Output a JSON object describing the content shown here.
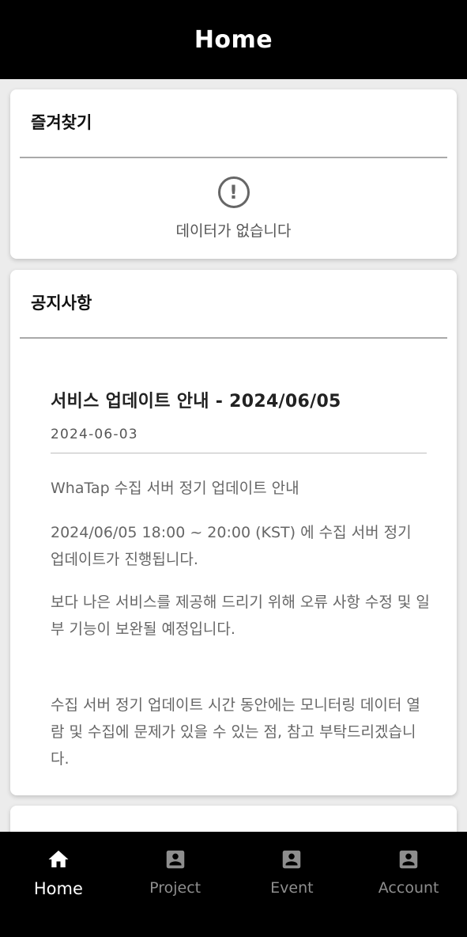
{
  "header": {
    "title": "Home"
  },
  "favorites": {
    "title": "즐겨찾기",
    "empty_icon": "alert-circle-icon",
    "empty_text": "데이터가 없습니다"
  },
  "notice": {
    "title": "공지사항",
    "items": [
      {
        "title": "서비스 업데이트 안내 - 2024/06/05",
        "date": "2024-06-03",
        "paragraphs": [
          "WhaTap 수집 서버 정기 업데이트 안내",
          "2024/06/05 18:00 ~ 20:00 (KST) 에 수집 서버 정기 업데이트가 진행됩니다.",
          "보다 나은 서비스를 제공해 드리기 위해 오류 사항 수정 및 일부 기능이 보완될 예정입니다.",
          "수집 서버 정기 업데이트 시간 동안에는 모니터링 데이터 열람 및 수집에 문제가 있을 수 있는 점, 참고 부탁드리겠습니다."
        ]
      }
    ]
  },
  "bottom_nav": {
    "items": [
      {
        "label": "Home",
        "icon": "home-icon",
        "active": true
      },
      {
        "label": "Project",
        "icon": "account-box-icon",
        "active": false
      },
      {
        "label": "Event",
        "icon": "account-box-icon",
        "active": false
      },
      {
        "label": "Account",
        "icon": "account-box-icon",
        "active": false
      }
    ]
  },
  "colors": {
    "header_bg": "#000000",
    "nav_active": "#ffffff",
    "nav_inactive": "#8e8e8e",
    "page_bg": "#ececec"
  }
}
